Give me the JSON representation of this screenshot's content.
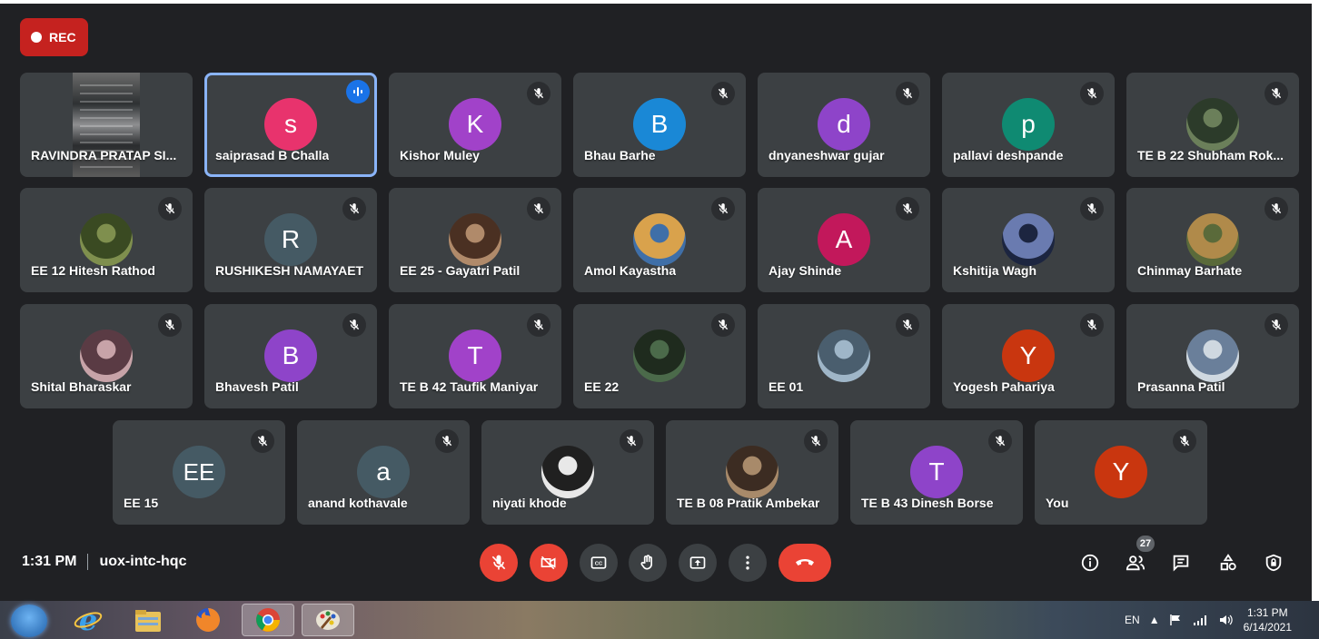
{
  "recording": {
    "label": "REC"
  },
  "participants": [
    {
      "name": "RAVINDRA PRATAP SI...",
      "type": "video",
      "muted": false
    },
    {
      "name": "saiprasad B Challa",
      "initial": "s",
      "color": "#e8336d",
      "speaking": true
    },
    {
      "name": "Kishor Muley",
      "initial": "K",
      "color": "#a142c9",
      "muted": true
    },
    {
      "name": "Bhau Barhe",
      "initial": "B",
      "color": "#1a88d6",
      "muted": true
    },
    {
      "name": "dnyaneshwar gujar",
      "initial": "d",
      "color": "#8e44c9",
      "muted": true
    },
    {
      "name": "pallavi deshpande",
      "initial": "p",
      "color": "#0f8a72",
      "muted": true
    },
    {
      "name": "TE B 22 Shubham Rok...",
      "type": "photo",
      "muted": true
    },
    {
      "name": "EE 12 Hitesh Rathod",
      "type": "photo",
      "muted": true
    },
    {
      "name": "RUSHIKESH NAMAYAET",
      "initial": "R",
      "color": "#455a64",
      "muted": true
    },
    {
      "name": "EE 25 - Gayatri Patil",
      "type": "photo",
      "muted": true
    },
    {
      "name": "Amol Kayastha",
      "type": "photo",
      "muted": true
    },
    {
      "name": "Ajay Shinde",
      "initial": "A",
      "color": "#c2185b",
      "muted": true
    },
    {
      "name": "Kshitija Wagh",
      "type": "photo",
      "muted": true
    },
    {
      "name": "Chinmay Barhate",
      "type": "photo",
      "muted": true
    },
    {
      "name": "Shital Bharaskar",
      "type": "photo",
      "muted": true
    },
    {
      "name": "Bhavesh Patil",
      "initial": "B",
      "color": "#8e44c9",
      "muted": true
    },
    {
      "name": "TE B 42 Taufik Maniyar",
      "initial": "T",
      "color": "#a142c9",
      "muted": true
    },
    {
      "name": "EE 22",
      "type": "photo",
      "muted": true
    },
    {
      "name": "EE 01",
      "type": "photo",
      "muted": true
    },
    {
      "name": "Yogesh Pahariya",
      "initial": "Y",
      "color": "#c9360f",
      "muted": true
    },
    {
      "name": "Prasanna Patil",
      "type": "photo",
      "muted": true
    },
    {
      "name": "EE 15",
      "initial": "EE",
      "color": "#455a64",
      "muted": true
    },
    {
      "name": "anand kothavale",
      "initial": "a",
      "color": "#455a64",
      "muted": true
    },
    {
      "name": "niyati khode",
      "type": "photo",
      "muted": true
    },
    {
      "name": "TE B 08 Pratik Ambekar",
      "type": "photo",
      "muted": true
    },
    {
      "name": "TE B 43 Dinesh Borse",
      "initial": "T",
      "color": "#8e44c9",
      "muted": true
    },
    {
      "name": "You",
      "initial": "Y",
      "color": "#c9360f",
      "muted": true
    }
  ],
  "meeting": {
    "time": "1:31 PM",
    "code": "uox-intc-hqc"
  },
  "people_count": "27",
  "taskbar": {
    "language": "EN",
    "time": "1:31 PM",
    "date": "6/14/2021"
  },
  "colors": {
    "background": "#202124",
    "tile": "#3c4043",
    "danger": "#ea4335",
    "accent": "#1a73e8"
  }
}
